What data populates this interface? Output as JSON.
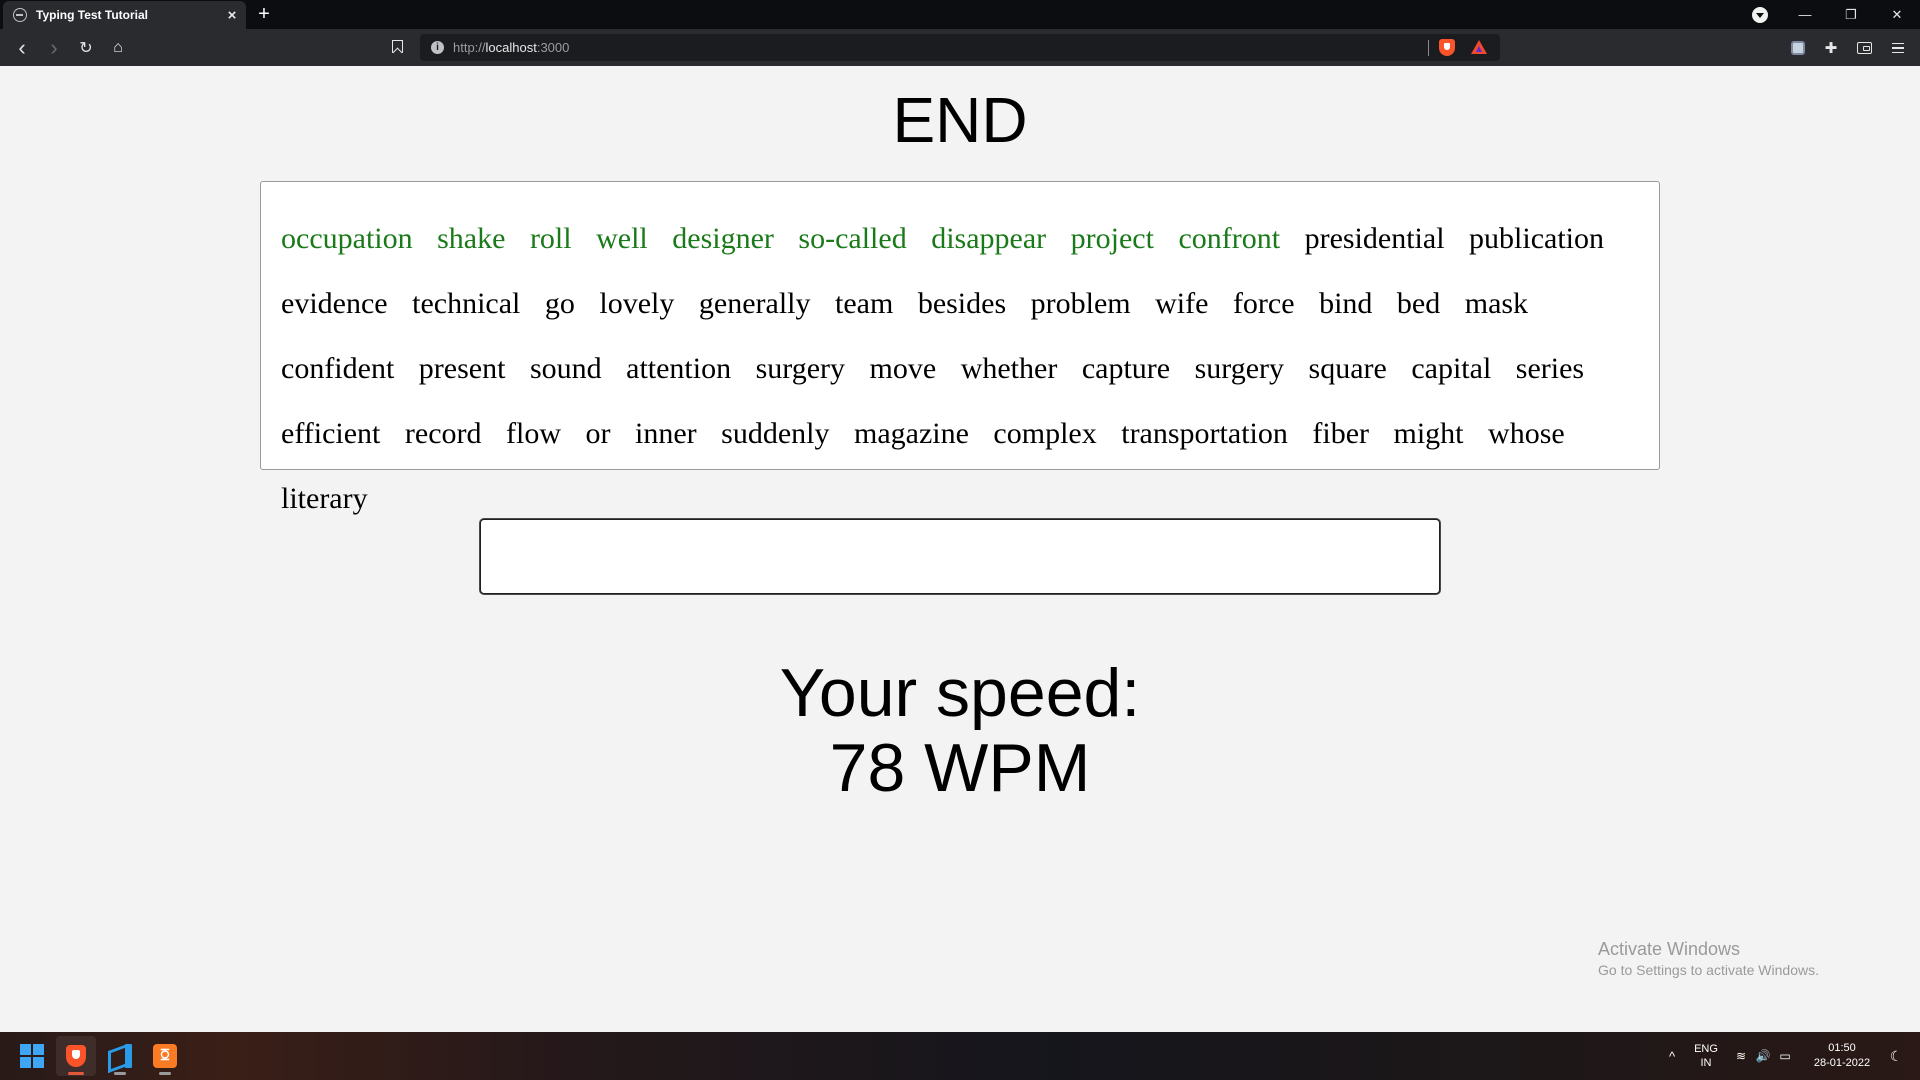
{
  "browser": {
    "tab_title": "Typing Test Tutorial",
    "tab_close": "×",
    "new_tab": "+",
    "url_scheme": "http://",
    "url_host": "localhost",
    "url_port": ":3000",
    "window_controls": {
      "minimize": "—",
      "restore": "❐",
      "close": "✕"
    },
    "nav": {
      "back": "‹",
      "forward": "›",
      "reload": "↻",
      "home": "⌂"
    }
  },
  "page": {
    "title": "END",
    "speed_label": "Your speed:",
    "speed_value": "78 WPM",
    "input_value": "",
    "correct_color": "#1a7a1a",
    "words": [
      {
        "text": "occupation",
        "correct": true
      },
      {
        "text": "shake",
        "correct": true
      },
      {
        "text": "roll",
        "correct": true
      },
      {
        "text": "well",
        "correct": true
      },
      {
        "text": "designer",
        "correct": true
      },
      {
        "text": "so-called",
        "correct": true
      },
      {
        "text": "disappear",
        "correct": true
      },
      {
        "text": "project",
        "correct": true
      },
      {
        "text": "confront",
        "correct": true
      },
      {
        "text": "presidential",
        "correct": false
      },
      {
        "text": "publication",
        "correct": false
      },
      {
        "text": "evidence",
        "correct": false
      },
      {
        "text": "technical",
        "correct": false
      },
      {
        "text": "go",
        "correct": false
      },
      {
        "text": "lovely",
        "correct": false
      },
      {
        "text": "generally",
        "correct": false
      },
      {
        "text": "team",
        "correct": false
      },
      {
        "text": "besides",
        "correct": false
      },
      {
        "text": "problem",
        "correct": false
      },
      {
        "text": "wife",
        "correct": false
      },
      {
        "text": "force",
        "correct": false
      },
      {
        "text": "bind",
        "correct": false
      },
      {
        "text": "bed",
        "correct": false
      },
      {
        "text": "mask",
        "correct": false
      },
      {
        "text": "confident",
        "correct": false
      },
      {
        "text": "present",
        "correct": false
      },
      {
        "text": "sound",
        "correct": false
      },
      {
        "text": "attention",
        "correct": false
      },
      {
        "text": "surgery",
        "correct": false
      },
      {
        "text": "move",
        "correct": false
      },
      {
        "text": "whether",
        "correct": false
      },
      {
        "text": "capture",
        "correct": false
      },
      {
        "text": "surgery",
        "correct": false
      },
      {
        "text": "square",
        "correct": false
      },
      {
        "text": "capital",
        "correct": false
      },
      {
        "text": "series",
        "correct": false
      },
      {
        "text": "efficient",
        "correct": false
      },
      {
        "text": "record",
        "correct": false
      },
      {
        "text": "flow",
        "correct": false
      },
      {
        "text": "or",
        "correct": false
      },
      {
        "text": "inner",
        "correct": false
      },
      {
        "text": "suddenly",
        "correct": false
      },
      {
        "text": "magazine",
        "correct": false
      },
      {
        "text": "complex",
        "correct": false
      },
      {
        "text": "transportation",
        "correct": false
      },
      {
        "text": "fiber",
        "correct": false
      },
      {
        "text": "might",
        "correct": false
      },
      {
        "text": "whose",
        "correct": false
      },
      {
        "text": "literary",
        "correct": false
      }
    ]
  },
  "watermark": {
    "line1": "Activate Windows",
    "line2": "Go to Settings to activate Windows."
  },
  "taskbar": {
    "xampp_glyph": "ꗞ",
    "tray_chevron": "^",
    "lang_line1": "ENG",
    "lang_line2": "IN",
    "time": "01:50",
    "date": "28-01-2022",
    "wifi_glyph": "≋",
    "volume_glyph": "🔊",
    "battery_glyph": "▭",
    "moon_glyph": "☾"
  }
}
